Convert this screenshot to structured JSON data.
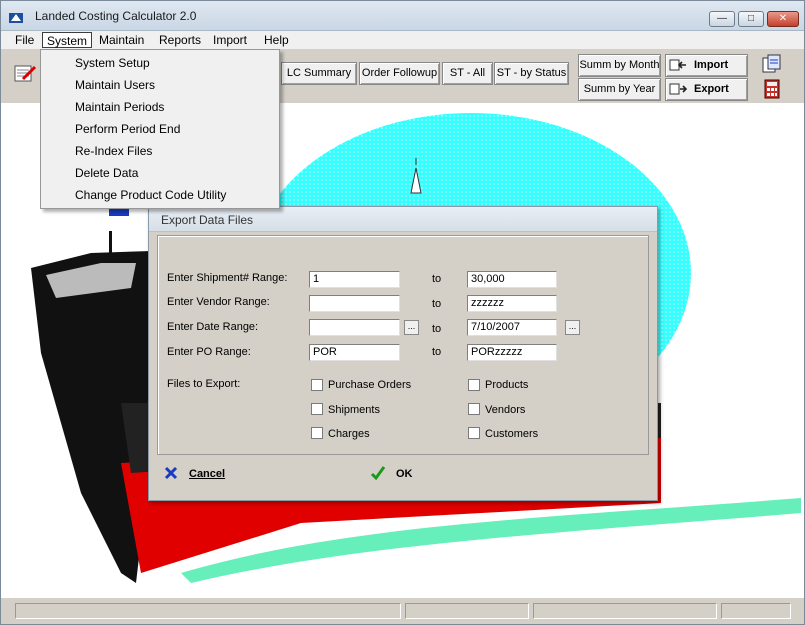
{
  "window": {
    "title": "Landed Costing Calculator 2.0"
  },
  "menubar": [
    "File",
    "System",
    "Maintain",
    "Reports",
    "Import",
    "Help"
  ],
  "system_menu": [
    "System Setup",
    "Maintain Users",
    "Maintain Periods",
    "Perform Period End",
    "Re-Index Files",
    "Delete Data",
    "Change Product Code Utility"
  ],
  "toolbar": {
    "lc_summary": "LC Summary",
    "order_followup": "Order Followup",
    "st_all": "ST - All",
    "st_by_status": "ST - by Status",
    "summ_by_month": "Summ by Month",
    "summ_by_year": "Summ by Year",
    "import": "Import",
    "export": "Export"
  },
  "dialog": {
    "title": "Export Data Files",
    "shipment_label": "Enter Shipment# Range:",
    "vendor_label": "Enter Vendor Range:",
    "date_label": "Enter Date Range:",
    "po_label": "Enter PO Range:",
    "to": "to",
    "shipment_from": "1",
    "shipment_to": "30,000",
    "vendor_from": "",
    "vendor_to": "zzzzzz",
    "date_from": "",
    "date_to": "7/10/2007",
    "po_from": "POR",
    "po_to": "PORzzzzz",
    "ellipsis": "...",
    "files_label": "Files to Export:",
    "files": [
      "Purchase Orders",
      "Products",
      "Shipments",
      "Vendors",
      "Charges",
      "Customers"
    ],
    "cancel": "Cancel",
    "ok": "OK"
  },
  "colors": {
    "sea": "#33ffff",
    "hull_red": "#e00000",
    "wave": "#66eebb",
    "accent_blue": "#1a3bbf"
  }
}
